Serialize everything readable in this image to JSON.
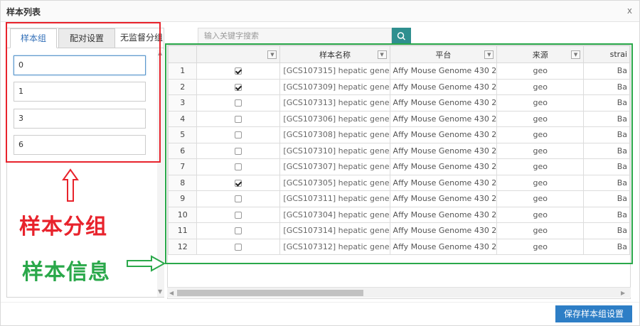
{
  "dialog": {
    "title": "样本列表",
    "close_label": "x"
  },
  "left_tabs": [
    "样本组",
    "配对设置",
    "无监督分组"
  ],
  "groups": [
    "0",
    "1",
    "3",
    "6"
  ],
  "annotations": {
    "group_label": "样本分组",
    "info_label": "样本信息"
  },
  "search": {
    "placeholder": "输入关键字搜索"
  },
  "table": {
    "headers": {
      "name": "样本名称",
      "platform": "平台",
      "source": "来源",
      "strain": "strai"
    },
    "rows": [
      {
        "num": "1",
        "checked": true,
        "name": "[GCS107315] hepatic gene",
        "platform": "Affy Mouse Genome 430 2",
        "source": "geo",
        "strain": "Ba"
      },
      {
        "num": "2",
        "checked": true,
        "name": "[GCS107309] hepatic gene",
        "platform": "Affy Mouse Genome 430 2",
        "source": "geo",
        "strain": "Ba"
      },
      {
        "num": "3",
        "checked": false,
        "name": "[GCS107313] hepatic gene",
        "platform": "Affy Mouse Genome 430 2",
        "source": "geo",
        "strain": "Ba"
      },
      {
        "num": "4",
        "checked": false,
        "name": "[GCS107306] hepatic gene",
        "platform": "Affy Mouse Genome 430 2",
        "source": "geo",
        "strain": "Ba"
      },
      {
        "num": "5",
        "checked": false,
        "name": "[GCS107308] hepatic gene",
        "platform": "Affy Mouse Genome 430 2",
        "source": "geo",
        "strain": "Ba"
      },
      {
        "num": "6",
        "checked": false,
        "name": "[GCS107310] hepatic gene",
        "platform": "Affy Mouse Genome 430 2",
        "source": "geo",
        "strain": "Ba"
      },
      {
        "num": "7",
        "checked": false,
        "name": "[GCS107307] hepatic gene",
        "platform": "Affy Mouse Genome 430 2",
        "source": "geo",
        "strain": "Ba"
      },
      {
        "num": "8",
        "checked": true,
        "name": "[GCS107305] hepatic gene",
        "platform": "Affy Mouse Genome 430 2",
        "source": "geo",
        "strain": "Ba"
      },
      {
        "num": "9",
        "checked": false,
        "name": "[GCS107311] hepatic gene",
        "platform": "Affy Mouse Genome 430 2",
        "source": "geo",
        "strain": "Ba"
      },
      {
        "num": "10",
        "checked": false,
        "name": "[GCS107304] hepatic gene",
        "platform": "Affy Mouse Genome 430 2",
        "source": "geo",
        "strain": "Ba"
      },
      {
        "num": "11",
        "checked": false,
        "name": "[GCS107314] hepatic gene",
        "platform": "Affy Mouse Genome 430 2",
        "source": "geo",
        "strain": "Ba"
      },
      {
        "num": "12",
        "checked": false,
        "name": "[GCS107312] hepatic gene",
        "platform": "Affy Mouse Genome 430 2",
        "source": "geo",
        "strain": "Ba"
      }
    ]
  },
  "footer": {
    "save_label": "保存样本组设置"
  },
  "colors": {
    "red_annotation": "#e8232c",
    "green_annotation": "#2aa84a",
    "primary_button": "#2d7ec6",
    "search_button": "#2f8f8f"
  },
  "icons": {
    "search": "search-icon",
    "filter": "filter-dropdown-icon"
  }
}
